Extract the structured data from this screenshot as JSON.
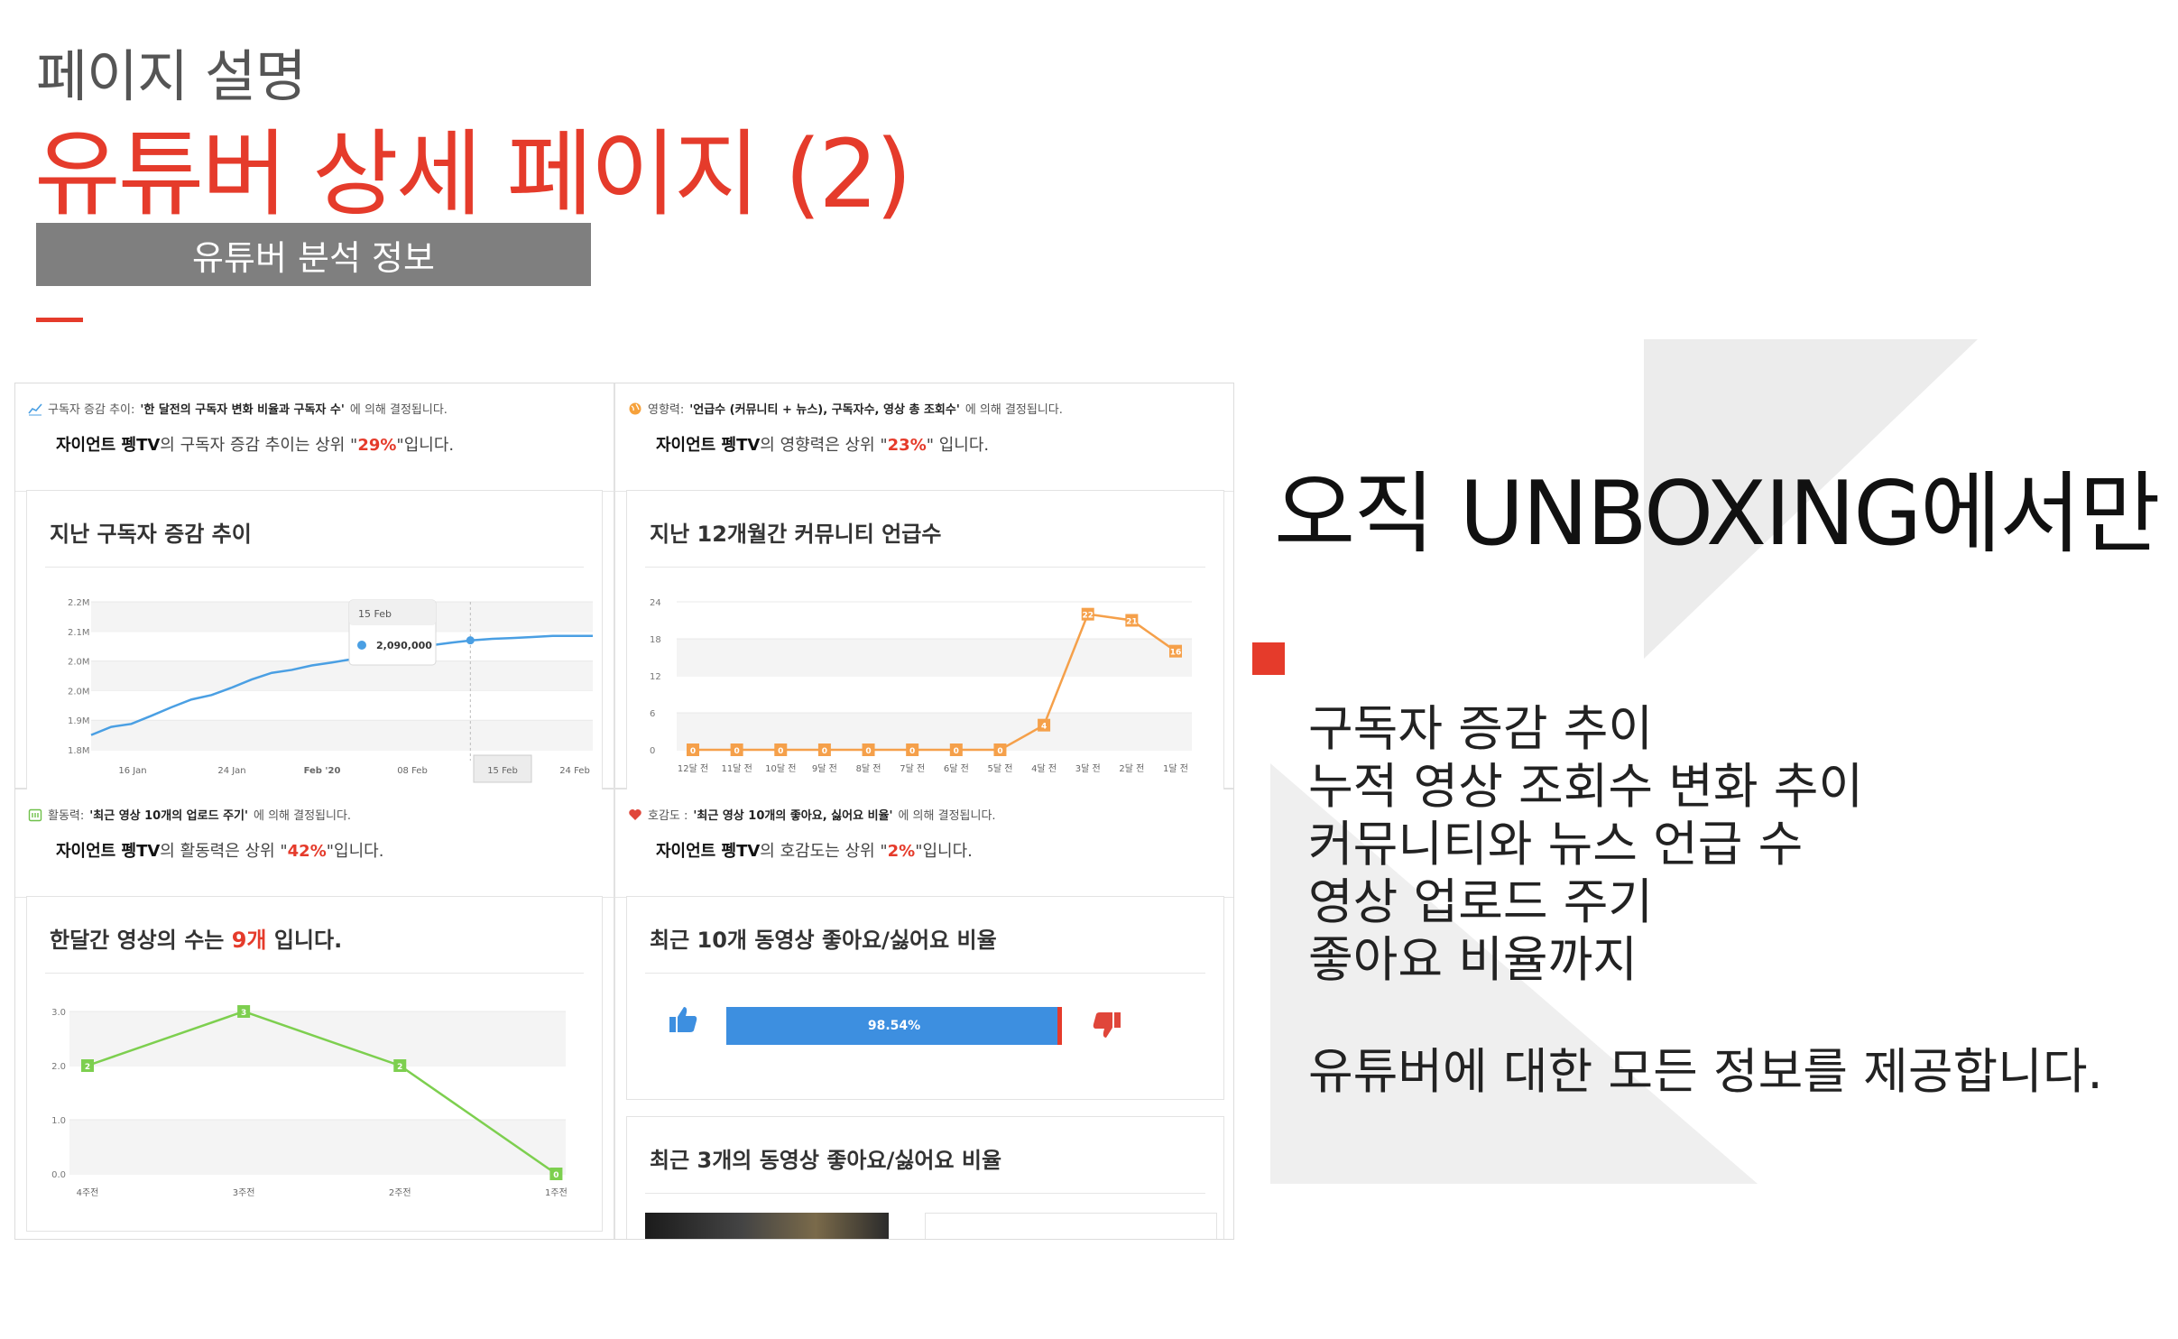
{
  "header": {
    "subtitle": "페이지 설명",
    "title": "유튜버 상세 페이지 (2)",
    "section_tab": "유튜버 분석 정보"
  },
  "colors": {
    "accent_red": "#e53b2b",
    "tab_gray": "#7f7f7f",
    "chart_blue": "#4a9fe3",
    "chart_orange": "#f5a04a",
    "chart_green": "#7dcf4f"
  },
  "feature": {
    "headline": "오직 UNBOXING에서만",
    "items": [
      "구독자 증감 추이",
      "누적 영상 조회수 변화 추이",
      "커뮤니티와 뉴스 언급 수",
      "영상 업로드 주기",
      "좋아요 비율까지"
    ],
    "closing": "유튜버에 대한 모든 정보를 제공합니다."
  },
  "panels": {
    "subscriber": {
      "icon": "trend-line-icon",
      "info_prefix": "구독자 증감 추이:",
      "info_bold": "'한 달전의 구독자 변화 비율과 구독자 수'",
      "info_suffix": "에 의해 결정됩니다.",
      "channel": "자이언트 펭TV",
      "rank_text_1": "의 구독자 증감 추이는 상위 \"",
      "rank_value": "29%",
      "rank_text_2": "\"입니다.",
      "card_title": "지난 구독자 증감 추이",
      "tooltip_date": "15 Feb",
      "tooltip_value": "2,090,000",
      "active_tick": "15 Feb"
    },
    "influence": {
      "icon": "globe-icon",
      "info_prefix": "영향력:",
      "info_bold": "'언급수 (커뮤니티 + 뉴스), 구독자수, 영상 총 조회수'",
      "info_suffix": "에 의해 결정됩니다.",
      "channel": "자이언트 펭TV",
      "rank_text_1": "의 영향력은 상위 \"",
      "rank_value": "23%",
      "rank_text_2": "\" 입니다.",
      "card_title": "지난 12개월간 커뮤니티 언급수"
    },
    "activity": {
      "icon": "calendar-icon",
      "info_prefix": "활동력:",
      "info_bold": "'최근 영상 10개의 업로드 주기'",
      "info_suffix": "에 의해 결정됩니다.",
      "channel": "자이언트 펭TV",
      "rank_text_1": "의 활동력은 상위 \"",
      "rank_value": "42%",
      "rank_text_2": "\"입니다.",
      "card_title_1": "한달간 영상의 수는 ",
      "card_title_value": "9개",
      "card_title_2": " 입니다."
    },
    "likability": {
      "icon": "heart-icon",
      "info_prefix": "호감도 :",
      "info_bold": "'최근 영상 10개의 좋아요, 싫어요 비율'",
      "info_suffix": "에 의해 결정됩니다.",
      "channel": "자이언트 펭TV",
      "rank_text_1": "의 호감도는 상위 \"",
      "rank_value": "2%",
      "rank_text_2": "\"입니다.",
      "card_title": "최근 10개 동영상 좋아요/싫어요 비율",
      "like_ratio_label": "98.54%",
      "like_ratio": 0.9854,
      "card2_title": "최근 3개의 동영상 좋아요/싫어요 비율"
    }
  },
  "chart_data": [
    {
      "type": "line",
      "x": [
        "16 Jan",
        "24 Jan",
        "Feb '20",
        "08 Feb",
        "15 Feb",
        "24 Feb"
      ],
      "y_ticks": [
        "1.8M",
        "1.9M",
        "2.0M",
        "2.0M",
        "2.1M",
        "2.2M"
      ],
      "ylim": [
        1800000,
        2200000
      ],
      "series": [
        {
          "values": [
            1840000,
            1862000,
            1870000,
            1892000,
            1915000,
            1936000,
            1948000,
            1968000,
            1990000,
            2008000,
            2016000,
            2028000,
            2036000,
            2045000,
            2052000,
            2068000,
            2076000,
            2083000,
            2090000,
            2096000,
            2100000,
            2102000,
            2105000,
            2108000,
            2108000,
            2108000
          ]
        }
      ]
    },
    {
      "type": "line",
      "x": [
        "12달 전",
        "11달 전",
        "10달 전",
        "9달 전",
        "8달 전",
        "7달 전",
        "6달 전",
        "5달 전",
        "4달 전",
        "3달 전",
        "2달 전",
        "1달 전"
      ],
      "y_ticks": [
        "0",
        "6",
        "12",
        "18",
        "24"
      ],
      "ylim": [
        0,
        24
      ],
      "series": [
        {
          "values": [
            0,
            0,
            0,
            0,
            0,
            0,
            0,
            0,
            4,
            22,
            21,
            16
          ]
        }
      ]
    },
    {
      "type": "line",
      "x": [
        "4주전",
        "3주전",
        "2주전",
        "1주전"
      ],
      "y_ticks": [
        "0.0",
        "1.0",
        "2.0",
        "3.0"
      ],
      "ylim": [
        0,
        3
      ],
      "series": [
        {
          "values": [
            2,
            3,
            2,
            0
          ]
        }
      ]
    },
    {
      "type": "bar",
      "categories": [
        "좋아요"
      ],
      "values": [
        98.54
      ],
      "value_labels": [
        "98.54%"
      ]
    }
  ]
}
